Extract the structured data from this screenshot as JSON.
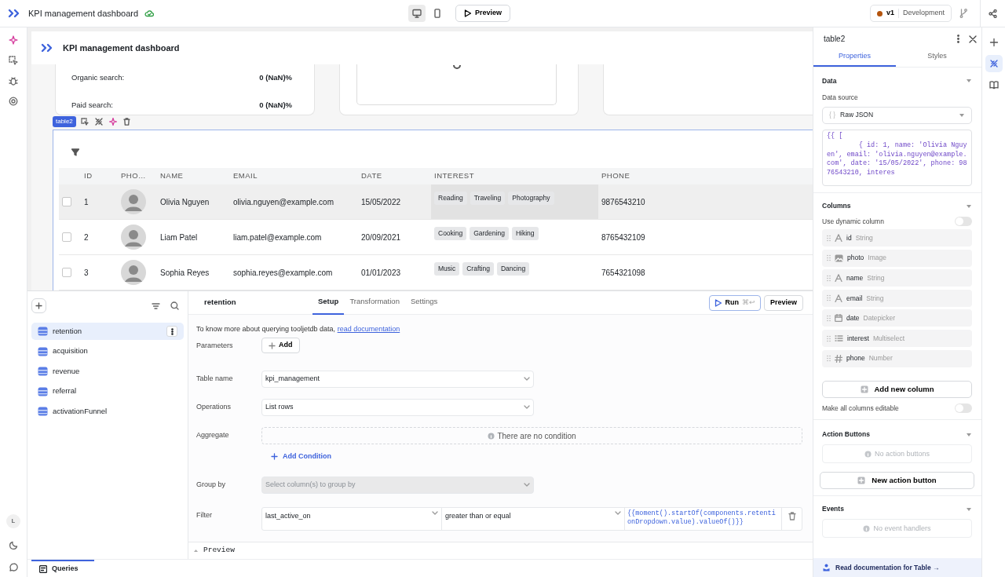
{
  "topbar": {
    "app_title": "KPI management dashboard",
    "view_modes": [
      {
        "kind": "desktop",
        "selected": true
      },
      {
        "kind": "mobile",
        "selected": false
      }
    ],
    "preview_button": "Preview",
    "version": "v1",
    "environment": "Development"
  },
  "left_rail": {
    "avatar": "L"
  },
  "canvas": {
    "app_title": "KPI management dashboard",
    "stats": [
      {
        "label": "Organic search:",
        "value": "0 (NaN)%"
      },
      {
        "label": "Paid search:",
        "value": "0 (NaN)%"
      }
    ],
    "widget_label": "table2",
    "table": {
      "columns": [
        "ID",
        "PHO…",
        "NAME",
        "EMAIL",
        "DATE",
        "INTEREST",
        "PHONE"
      ],
      "rows": [
        {
          "id": "1",
          "name": "Olivia Nguyen",
          "email": "olivia.nguyen@example.com",
          "date": "15/05/2022",
          "interest": [
            "Reading",
            "Traveling",
            "Photography"
          ],
          "phone": "9876543210",
          "checked": false,
          "highlighted": true
        },
        {
          "id": "2",
          "name": "Liam Patel",
          "email": "liam.patel@example.com",
          "date": "20/09/2021",
          "interest": [
            "Cooking",
            "Gardening",
            "Hiking"
          ],
          "phone": "8765432109",
          "checked": false,
          "highlighted": false
        },
        {
          "id": "3",
          "name": "Sophia Reyes",
          "email": "sophia.reyes@example.com",
          "date": "01/01/2023",
          "interest": [
            "Music",
            "Crafting",
            "Dancing"
          ],
          "phone": "7654321098",
          "checked": false,
          "highlighted": false
        }
      ]
    }
  },
  "queries": {
    "items": [
      {
        "name": "retention",
        "selected": true
      },
      {
        "name": "acquisition",
        "selected": false
      },
      {
        "name": "revenue",
        "selected": false
      },
      {
        "name": "referral",
        "selected": false
      },
      {
        "name": "activationFunnel",
        "selected": false
      }
    ],
    "bottom_tab": "Queries"
  },
  "query_editor": {
    "name": "retention",
    "tabs": [
      {
        "label": "Setup",
        "selected": true
      },
      {
        "label": "Transformation",
        "selected": false
      },
      {
        "label": "Settings",
        "selected": false
      }
    ],
    "run_button": "Run",
    "run_shortcut": "⌘↩",
    "preview_button": "Preview",
    "intro": "To know more about querying tooljetdb data,",
    "intro_link": "read documentation",
    "fields": [
      {
        "kind": "button",
        "label": "Parameters",
        "button": "Add"
      },
      {
        "kind": "select",
        "label": "Table name",
        "value": "kpi_management",
        "disabled": false
      },
      {
        "kind": "select",
        "label": "Operations",
        "value": "List rows",
        "disabled": false
      },
      {
        "kind": "conditions",
        "label": "Aggregate",
        "empty_text": "There are no condition",
        "add_link": "Add Condition"
      },
      {
        "kind": "select",
        "label": "Group by",
        "placeholder": "Select column(s) to group by",
        "disabled": true
      },
      {
        "kind": "filter",
        "label": "Filter",
        "column": "last_active_on",
        "operator": "greater than or equal",
        "value": "{{moment().startOf(components.retentionDropdown.value).valueOf()}}"
      }
    ],
    "preview_section": {
      "label": "Preview",
      "expanded": false
    }
  },
  "inspector": {
    "title": "table2",
    "tabs": [
      {
        "label": "Properties",
        "selected": true
      },
      {
        "label": "Styles",
        "selected": false
      }
    ],
    "data_section": {
      "title": "Data",
      "expanded": true,
      "source_label": "Data source",
      "source_icon": "{ }",
      "source_value": "Raw JSON",
      "code": "{{ [\n        { id: 1, name: 'Olivia Nguyen', email: 'olivia.nguyen@example.com', date: '15/05/2022', phone: 9876543210, interes"
    },
    "columns_section": {
      "title": "Columns",
      "expanded": true,
      "dynamic_label": "Use dynamic column",
      "dynamic_on": false,
      "columns": [
        {
          "name": "id",
          "type": "String",
          "kind": "string"
        },
        {
          "name": "photo",
          "type": "Image",
          "kind": "image"
        },
        {
          "name": "name",
          "type": "String",
          "kind": "string"
        },
        {
          "name": "email",
          "type": "String",
          "kind": "string"
        },
        {
          "name": "date",
          "type": "Datepicker",
          "kind": "date"
        },
        {
          "name": "interest",
          "type": "Multiselect",
          "kind": "multiselect"
        },
        {
          "name": "phone",
          "type": "Number",
          "kind": "number"
        }
      ],
      "add_button": "Add new column",
      "editable_label": "Make all columns editable",
      "editable_on": false
    },
    "actions_section": {
      "title": "Action Buttons",
      "expanded": true,
      "empty_text": "No action buttons",
      "add_button": "New action button"
    },
    "events_section": {
      "title": "Events",
      "expanded": true,
      "empty_text": "No event handlers"
    },
    "doc_link": "Read documentation for Table →"
  },
  "right_rail": {
    "items": [
      {
        "kind": "add",
        "selected": false
      },
      {
        "kind": "inspector",
        "selected": true
      },
      {
        "kind": "docs",
        "selected": false
      }
    ]
  }
}
